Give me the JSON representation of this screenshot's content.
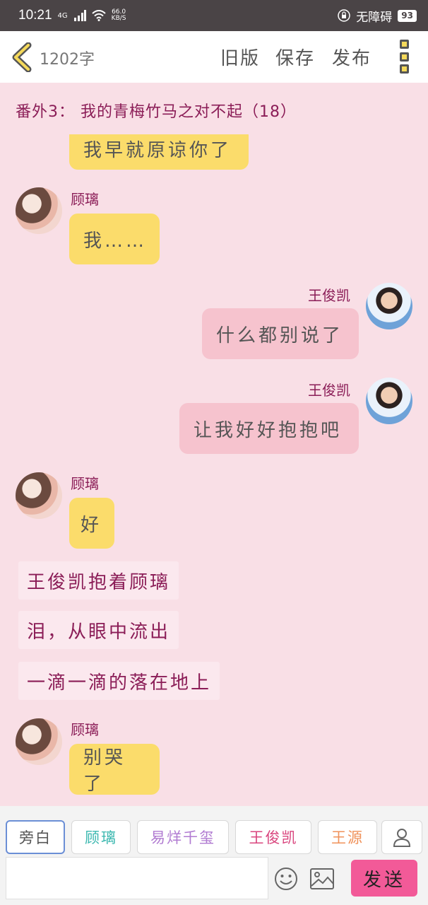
{
  "status_bar": {
    "time": "10:21",
    "network": "4G",
    "speed_value": "66.0",
    "speed_unit": "KB/S",
    "accessibility": "无障碍",
    "battery": "93"
  },
  "topnav": {
    "word_count": "1202字",
    "old_version": "旧版",
    "save": "保存",
    "publish": "发布"
  },
  "chapter_title": "番外3： 我的青梅竹马之对不起（18）",
  "messages": [
    {
      "side": "left",
      "text": "我早就原谅你了"
    },
    {
      "side": "left",
      "speaker": "顾璃",
      "text": "我……"
    },
    {
      "side": "right",
      "speaker": "王俊凯",
      "text": "什么都别说了"
    },
    {
      "side": "right",
      "speaker": "王俊凯",
      "text": "让我好好抱抱吧"
    },
    {
      "side": "left",
      "speaker": "顾璃",
      "text": "好"
    },
    {
      "side": "narration",
      "text": "王俊凯抱着顾璃"
    },
    {
      "side": "narration",
      "text": "泪，从眼中流出"
    },
    {
      "side": "narration",
      "text": "一滴一滴的落在地上"
    },
    {
      "side": "left",
      "speaker": "顾璃",
      "text": "别哭了"
    }
  ],
  "roles": [
    {
      "label": "旁白",
      "color": "#555555"
    },
    {
      "label": "顾璃",
      "color": "#3cb8b0"
    },
    {
      "label": "易烊千玺",
      "color": "#b07ad1"
    },
    {
      "label": "王俊凯",
      "color": "#d9457e"
    },
    {
      "label": "王源",
      "color": "#f0925a"
    }
  ],
  "send_label": "发送",
  "colors": {
    "background": "#f9dfe6",
    "yellow_bubble": "#fbdc6b",
    "pink_bubble": "#f6c3ce",
    "name_text": "#8b1d57",
    "send_button": "#f25a98"
  },
  "icons": [
    "back-chevron-icon",
    "menu-icon",
    "emoji-icon",
    "image-icon",
    "person-icon"
  ]
}
